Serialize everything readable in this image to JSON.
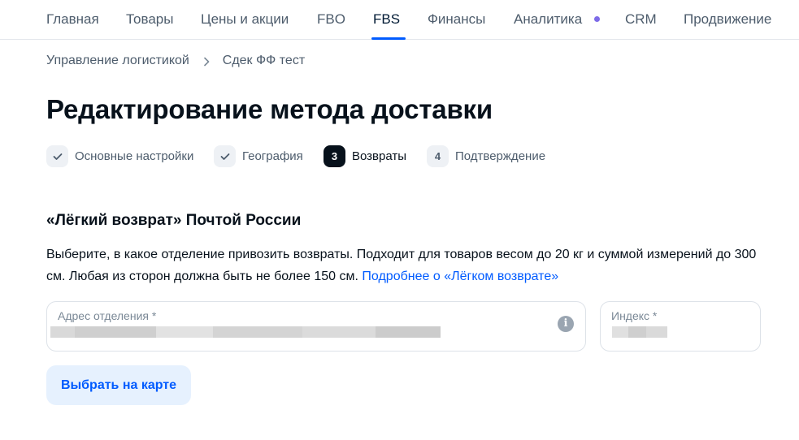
{
  "nav": {
    "items": [
      {
        "label": "Главная"
      },
      {
        "label": "Товары"
      },
      {
        "label": "Цены и акции"
      },
      {
        "label": "FBO"
      },
      {
        "label": "FBS"
      },
      {
        "label": "Финансы"
      },
      {
        "label": "Аналитика"
      },
      {
        "label": "CRM"
      },
      {
        "label": "Продвижение"
      }
    ],
    "active": "FBS"
  },
  "breadcrumb": {
    "parent": "Управление логистикой",
    "current": "Сдек ФФ тест"
  },
  "page_title": "Редактирование метода доставки",
  "stepper": {
    "steps": [
      {
        "badge": "✓",
        "label": "Основные настройки",
        "state": "done"
      },
      {
        "badge": "✓",
        "label": "География",
        "state": "done"
      },
      {
        "badge": "3",
        "label": "Возвраты",
        "state": "current"
      },
      {
        "badge": "4",
        "label": "Подтверждение",
        "state": "todo"
      }
    ]
  },
  "section": {
    "title": "«Лёгкий возврат» Почтой России",
    "description": "Выберите, в какое отделение привозить возвраты. Подходит для товаров весом до 20 кг и суммой измерений до 300 см. Любая из сторон должна быть не более 150 см. ",
    "link_text": "Подробнее о «Лёгком возврате»"
  },
  "address_field": {
    "label": "Адрес отделения *",
    "value_redacted": true,
    "info_icon": "info-icon"
  },
  "index_field": {
    "label": "Индекс *",
    "value_redacted": true
  },
  "map_button": {
    "label": "Выбрать на карте"
  },
  "colors": {
    "accent": "#005bff",
    "nav_dot": "#7d6be8",
    "current_step_bg": "#07111b",
    "button_bg": "#e6f1fe"
  }
}
